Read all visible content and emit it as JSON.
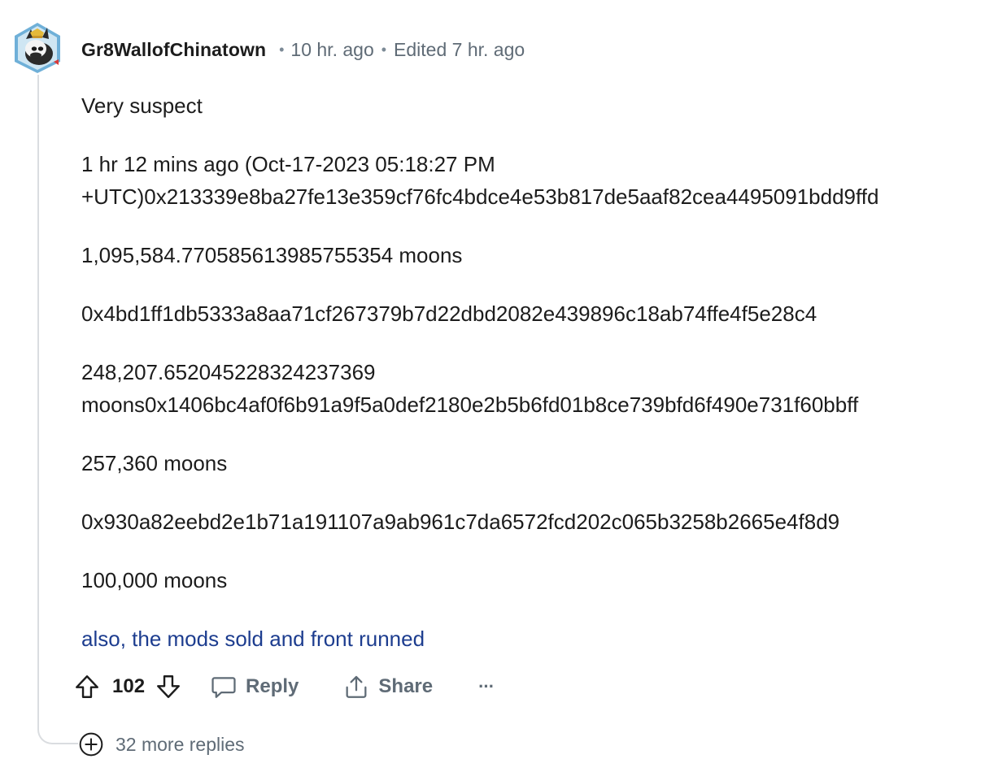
{
  "comment": {
    "author": "Gr8WallofChinatown",
    "posted": "10 hr. ago",
    "edited": "Edited 7 hr. ago",
    "separator": "•",
    "avatar_icon": "snoo-avatar-icon",
    "paragraphs": [
      "Very suspect",
      "1 hr 12 mins ago (Oct-17-2023 05:18:27 PM +UTC)0x213339e8ba27fe13e359cf76fc4bdce4e53b817de5aaf82cea4495091bdd9ffd",
      "1,095,584.770585613985755354 moons",
      "0x4bd1ff1db5333a8aa71cf267379b7d22dbd2082e439896c18ab74ffe4f5e28c4",
      "248,207.652045228324237369 moons0x1406bc4af0f6b91a9f5a0def2180e2b5b6fd01b8ce739bfd6f490e731f60bbff",
      "257,360 moons",
      "0x930a82eebd2e1b71a191107a9ab961c7da6572fcd202c065b3258b2665e4f8d9",
      "100,000 moons"
    ],
    "link_text": "also, the mods sold and front runned",
    "score": "102"
  },
  "actions": {
    "reply_label": "Reply",
    "share_label": "Share",
    "more_label": "···"
  },
  "thread": {
    "more_replies": "32 more replies"
  },
  "colors": {
    "text": "#1c1c1c",
    "meta": "#5f6b76",
    "link": "#1d3d8f",
    "thread_line": "#dadde0"
  }
}
